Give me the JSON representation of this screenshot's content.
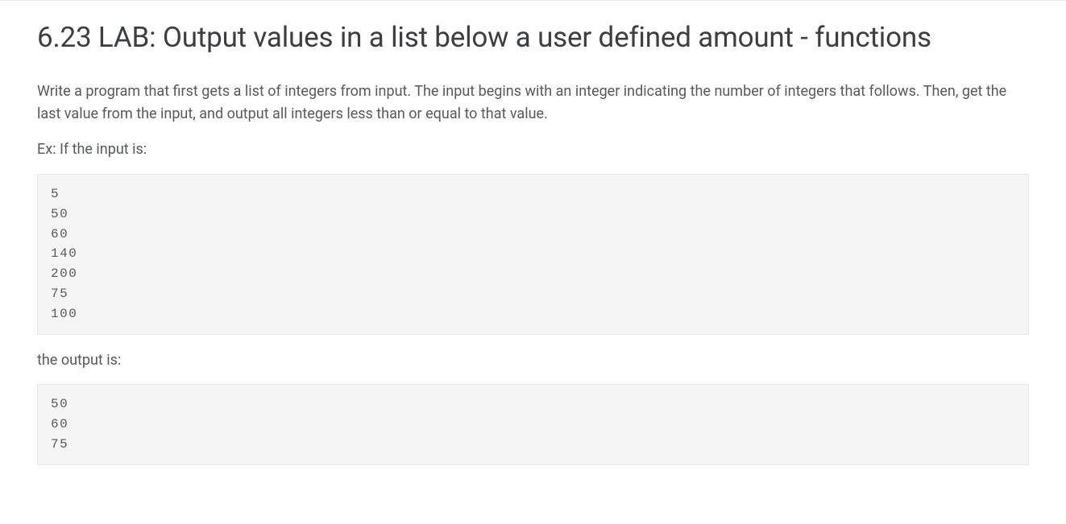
{
  "heading": "6.23 LAB: Output values in a list below a user defined amount - functions",
  "paragraph1": "Write a program that first gets a list of integers from input. The input begins with an integer indicating the number of integers that follows. Then, get the last value from the input, and output all integers less than or equal to that value.",
  "paragraph2": "Ex: If the input is:",
  "codeblock1": "5\n50\n60\n140\n200\n75\n100",
  "paragraph3": "the output is:",
  "codeblock2": "50\n60\n75"
}
